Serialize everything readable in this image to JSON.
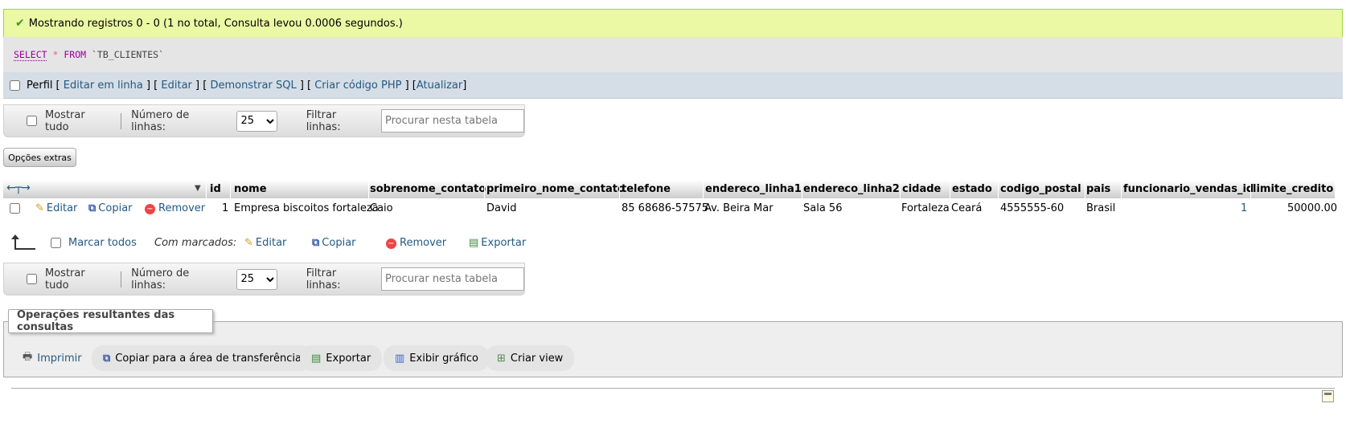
{
  "success": {
    "message": "Mostrando registros 0 - 0 (1 no total, Consulta levou 0.0006 segundos.)"
  },
  "sql": {
    "select": "SELECT",
    "star": "*",
    "from": "FROM",
    "table": "`TB_CLIENTES`"
  },
  "perfil": {
    "label": "Perfil",
    "links": [
      "Editar em linha",
      "Editar",
      "Demonstrar SQL",
      "Criar código PHP",
      "Atualizar"
    ]
  },
  "nav": {
    "show_all": "Mostrar tudo",
    "rows_label": "Número de linhas:",
    "rows_value": "25",
    "filter_label": "Filtrar linhas:",
    "filter_placeholder": "Procurar nesta tabela"
  },
  "extras_label": "Opções extras",
  "table": {
    "columns": [
      "id",
      "nome",
      "sobrenome_contato",
      "primeiro_nome_contato",
      "telefone",
      "endereco_linha1",
      "endereco_linha2",
      "cidade",
      "estado",
      "codigo_postal",
      "pais",
      "funcionario_vendas_id",
      "limite_credito"
    ],
    "row_actions": {
      "edit": "Editar",
      "copy": "Copiar",
      "remove": "Remover"
    },
    "rows": [
      [
        "1",
        "Empresa biscoitos fortaleza",
        "Caio",
        "David",
        "85 68686-57575",
        "Av. Beira Mar",
        "Sala 56",
        "Fortaleza",
        "Ceará",
        "4555555-60",
        "Brasil",
        "1",
        "50000.00"
      ]
    ]
  },
  "with_selected": {
    "check_all": "Marcar todos",
    "label": "Com marcados:",
    "edit": "Editar",
    "copy": "Copiar",
    "remove": "Remover",
    "export": "Exportar"
  },
  "operations": {
    "legend": "Operações resultantes das consultas",
    "print": "Imprimir",
    "copy_clipboard": "Copiar para a área de transferência",
    "export": "Exportar",
    "chart": "Exibir gráfico",
    "create_view": "Criar view"
  }
}
